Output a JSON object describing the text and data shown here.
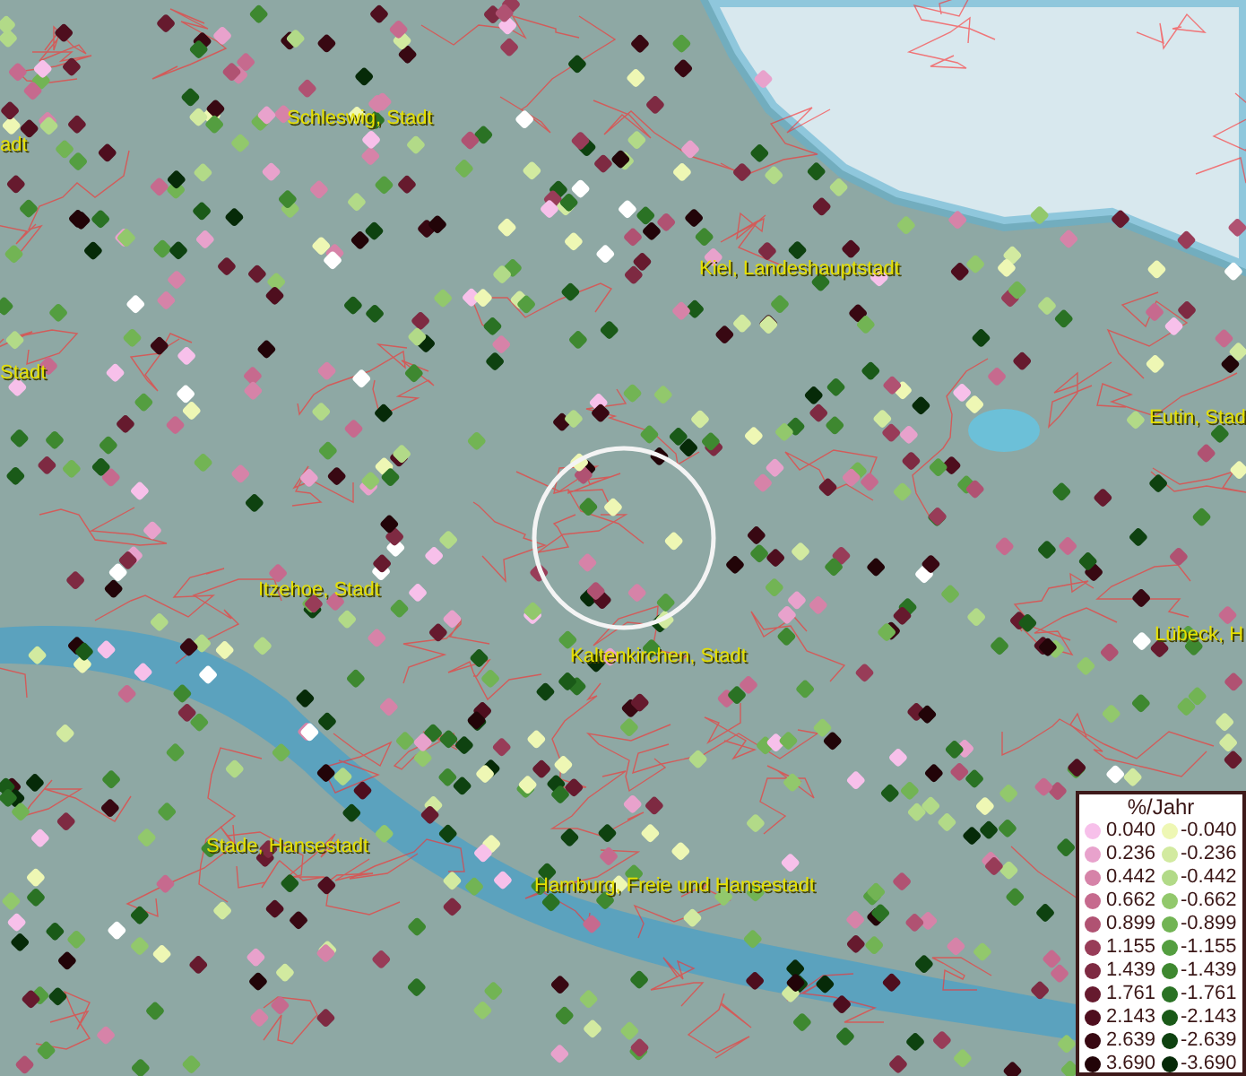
{
  "map": {
    "places": [
      {
        "label": "Schleswig, Stadt"
      },
      {
        "label": "adt"
      },
      {
        "label": "Kiel, Landeshauptstadt"
      },
      {
        "label": "Stadt"
      },
      {
        "label": "Eutin, Stad"
      },
      {
        "label": "Itzehoe, Stadt"
      },
      {
        "label": "Kaltenkirchen, Stadt"
      },
      {
        "label": "Lübeck, H"
      },
      {
        "label": "Stade, Hansestadt"
      },
      {
        "label": "Hamburg, Freie und Hansestadt"
      }
    ]
  },
  "legend": {
    "title": "%/Jahr",
    "positive": [
      {
        "label": "0.040",
        "color": "#f7c0ea"
      },
      {
        "label": "0.236",
        "color": "#e8a2cc"
      },
      {
        "label": "0.442",
        "color": "#d683a8"
      },
      {
        "label": "0.662",
        "color": "#c66a8e"
      },
      {
        "label": "0.899",
        "color": "#b05272"
      },
      {
        "label": "1.155",
        "color": "#983c58"
      },
      {
        "label": "1.439",
        "color": "#7e2a42"
      },
      {
        "label": "1.761",
        "color": "#661a2e"
      },
      {
        "label": "2.143",
        "color": "#4e0e1e"
      },
      {
        "label": "2.639",
        "color": "#380812"
      },
      {
        "label": "3.690",
        "color": "#220408"
      }
    ],
    "negative": [
      {
        "label": "-0.040",
        "color": "#eef7b4"
      },
      {
        "label": "-0.236",
        "color": "#d2eaa0"
      },
      {
        "label": "-0.442",
        "color": "#b2da88"
      },
      {
        "label": "-0.662",
        "color": "#92c86c"
      },
      {
        "label": "-0.899",
        "color": "#72b454"
      },
      {
        "label": "-1.155",
        "color": "#549e40"
      },
      {
        "label": "-1.439",
        "color": "#3e8830"
      },
      {
        "label": "-1.761",
        "color": "#2a7224"
      },
      {
        "label": "-2.143",
        "color": "#1a5a18"
      },
      {
        "label": "-2.639",
        "color": "#0e4210"
      },
      {
        "label": "-3.690",
        "color": "#062a08"
      }
    ]
  }
}
